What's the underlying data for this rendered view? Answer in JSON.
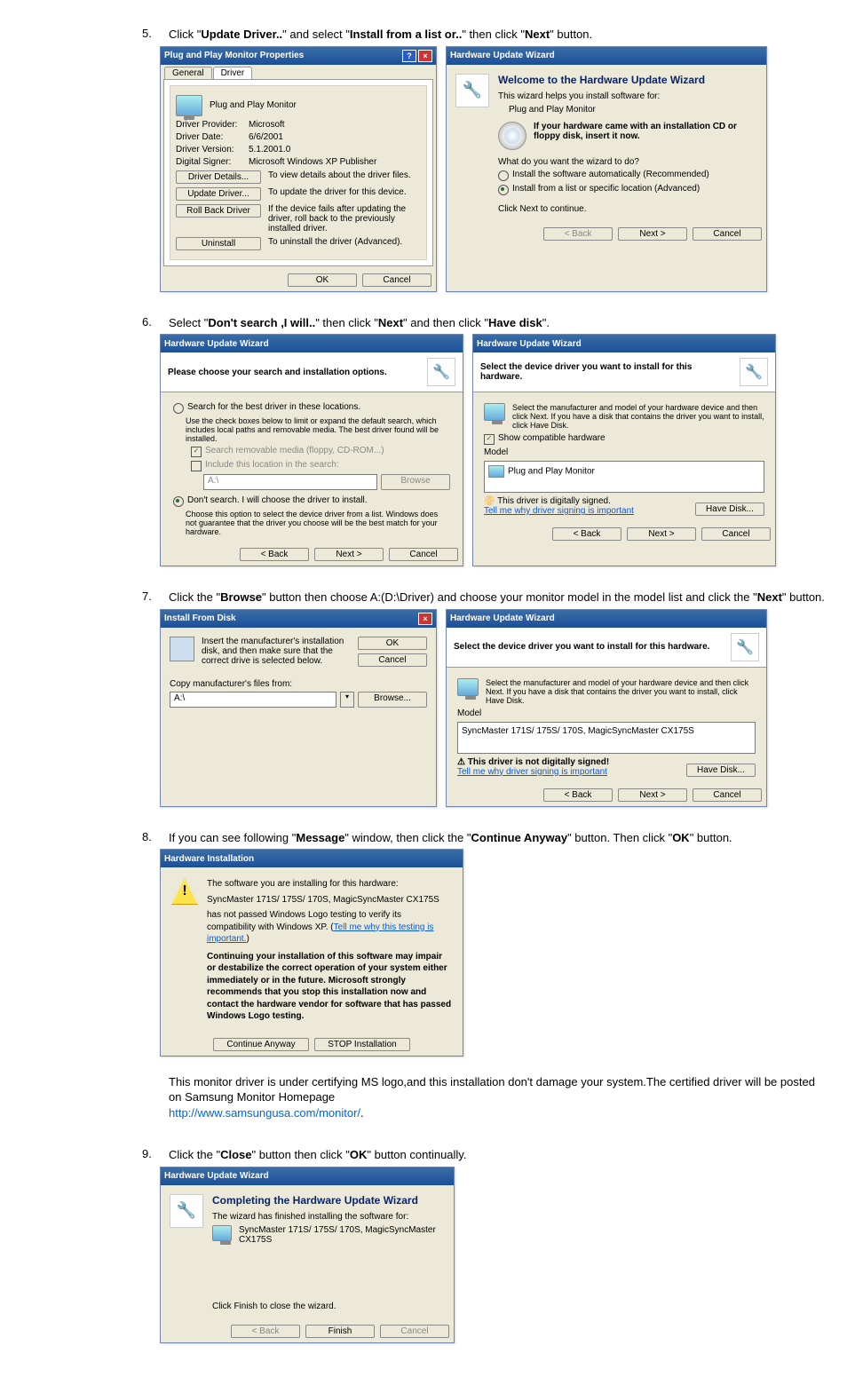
{
  "steps": {
    "s5": {
      "num": "5.",
      "text_pre": "Click \"",
      "b1": "Update Driver..",
      "text_mid1": "\" and select \"",
      "b2": "Install from a list or..",
      "text_mid2": "\" then click \"",
      "b3": "Next",
      "text_post": "\" button."
    },
    "s6": {
      "num": "6.",
      "text_pre": "Select \"",
      "b1": "Don't search ,I will..",
      "text_mid1": "\" then click \"",
      "b2": "Next",
      "text_mid2": "\" and then click \"",
      "b3": "Have disk",
      "text_post": "\"."
    },
    "s7": {
      "num": "7.",
      "text_pre": "Click the \"",
      "b1": "Browse",
      "text_mid1": "\" button then choose A:(D:\\Driver) and choose your monitor model in the model list and click the \"",
      "b2": "Next",
      "text_post": "\" button."
    },
    "s8": {
      "num": "8.",
      "text_pre": "If you can see following \"",
      "b1": "Message",
      "text_mid1": "\" window, then click the \"",
      "b2": "Continue Anyway",
      "text_mid2": "\" button. Then click \"",
      "b3": "OK",
      "text_post": "\" button."
    },
    "s8_note": "This monitor driver is under certifying MS logo,and this installation don't damage your system.The certified driver will be posted on Samsung Monitor Homepage ",
    "s8_link": "http://www.samsungusa.com/monitor/",
    "s8_link_after": ".",
    "s9": {
      "num": "9.",
      "text_pre": "Click the \"",
      "b1": "Close",
      "text_mid1": "\" button then click \"",
      "b2": "OK",
      "text_post": "\" button continually."
    }
  },
  "dlg_props": {
    "title": "Plug and Play Monitor Properties",
    "tab_general": "General",
    "tab_driver": "Driver",
    "device": "Plug and Play Monitor",
    "provider_l": "Driver Provider:",
    "provider_v": "Microsoft",
    "date_l": "Driver Date:",
    "date_v": "6/6/2001",
    "ver_l": "Driver Version:",
    "ver_v": "5.1.2001.0",
    "signer_l": "Digital Signer:",
    "signer_v": "Microsoft Windows XP Publisher",
    "btn_details": "Driver Details...",
    "btn_details_d": "To view details about the driver files.",
    "btn_update": "Update Driver...",
    "btn_update_d": "To update the driver for this device.",
    "btn_rollback": "Roll Back Driver",
    "btn_rollback_d": "If the device fails after updating the driver, roll back to the previously installed driver.",
    "btn_uninstall": "Uninstall",
    "btn_uninstall_d": "To uninstall the driver (Advanced).",
    "ok": "OK",
    "cancel": "Cancel"
  },
  "dlg_wiz1": {
    "title": "Hardware Update Wizard",
    "h": "Welcome to the Hardware Update Wizard",
    "sub": "This wizard helps you install software for:",
    "dev": "Plug and Play Monitor",
    "cd": "If your hardware came with an installation CD or floppy disk, insert it now.",
    "q": "What do you want the wizard to do?",
    "r1": "Install the software automatically (Recommended)",
    "r2": "Install from a list or specific location (Advanced)",
    "cont": "Click Next to continue.",
    "back": "< Back",
    "next": "Next >",
    "cancel": "Cancel"
  },
  "dlg_wiz2": {
    "title": "Hardware Update Wizard",
    "hdr": "Please choose your search and installation options.",
    "r1": "Search for the best driver in these locations.",
    "r1_d": "Use the check boxes below to limit or expand the default search, which includes local paths and removable media. The best driver found will be installed.",
    "c1": "Search removable media (floppy, CD-ROM...)",
    "c2": "Include this location in the search:",
    "path": "A:\\",
    "browse": "Browse",
    "r2": "Don't search. I will choose the driver to install.",
    "r2_d": "Choose this option to select the device driver from a list. Windows does not guarantee that the driver you choose will be the best match for your hardware.",
    "back": "< Back",
    "next": "Next >",
    "cancel": "Cancel"
  },
  "dlg_wiz3": {
    "title": "Hardware Update Wizard",
    "hdr": "Select the device driver you want to install for this hardware.",
    "sub": "Select the manufacturer and model of your hardware device and then click Next. If you have a disk that contains the driver you want to install, click Have Disk.",
    "show": "Show compatible hardware",
    "model_l": "Model",
    "model": "Plug and Play Monitor",
    "signed": "This driver is digitally signed.",
    "link": "Tell me why driver signing is important",
    "have_disk": "Have Disk...",
    "back": "< Back",
    "next": "Next >",
    "cancel": "Cancel"
  },
  "dlg_install_from_disk": {
    "title": "Install From Disk",
    "msg": "Insert the manufacturer's installation disk, and then make sure that the correct drive is selected below.",
    "ok": "OK",
    "cancel": "Cancel",
    "copy": "Copy manufacturer's files from:",
    "path": "A:\\",
    "browse": "Browse..."
  },
  "dlg_wiz4": {
    "title": "Hardware Update Wizard",
    "hdr": "Select the device driver you want to install for this hardware.",
    "sub": "Select the manufacturer and model of your hardware device and then click Next. If you have a disk that contains the driver you want to install, click Have Disk.",
    "model_l": "Model",
    "model": "SyncMaster 171S/ 175S/ 170S, MagicSyncMaster CX175S",
    "notsigned": "This driver is not digitally signed!",
    "link": "Tell me why driver signing is important",
    "have_disk": "Have Disk...",
    "back": "< Back",
    "next": "Next >",
    "cancel": "Cancel"
  },
  "dlg_hwinstall": {
    "title": "Hardware Installation",
    "l1": "The software you are installing for this hardware:",
    "l2": "SyncMaster 171S/ 175S/ 170S, MagicSyncMaster CX175S",
    "l3a": "has not passed Windows Logo testing to verify its compatibility with Windows XP. (",
    "l3b": "Tell me why this testing is important.",
    "l3c": ")",
    "l4": "Continuing your installation of this software may impair or destabilize the correct operation of your system either immediately or in the future. Microsoft strongly recommends that you stop this installation now and contact the hardware vendor for software that has passed Windows Logo testing.",
    "cont": "Continue Anyway",
    "stop": "STOP Installation"
  },
  "dlg_complete": {
    "title": "Hardware Update Wizard",
    "h": "Completing the Hardware Update Wizard",
    "sub": "The wizard has finished installing the software for:",
    "dev": "SyncMaster 171S/ 175S/ 170S, MagicSyncMaster CX175S",
    "close": "Click Finish to close the wizard.",
    "back": "< Back",
    "finish": "Finish",
    "cancel": "Cancel"
  }
}
